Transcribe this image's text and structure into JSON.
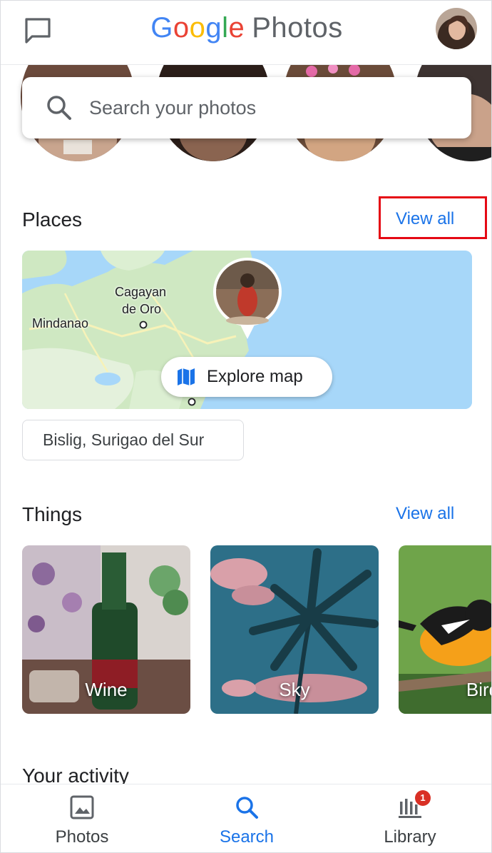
{
  "header": {
    "logo_google": [
      "G",
      "o",
      "o",
      "g",
      "l",
      "e"
    ],
    "logo_photos": "Photos"
  },
  "search": {
    "placeholder": "Search your photos"
  },
  "places": {
    "title": "Places",
    "view_all": "View all",
    "map_labels": {
      "cagayan": "Cagayan",
      "de_oro": "de Oro",
      "mindanao": "Mindanao"
    },
    "explore_map": "Explore map",
    "chip": "Bislig, Surigao del Sur"
  },
  "things": {
    "title": "Things",
    "view_all": "View all",
    "items": [
      {
        "label": "Wine"
      },
      {
        "label": "Sky"
      },
      {
        "label": "Bird"
      }
    ]
  },
  "activity": {
    "title": "Your activity"
  },
  "bottom_nav": {
    "items": [
      {
        "label": "Photos",
        "icon": "image-icon"
      },
      {
        "label": "Search",
        "icon": "search-icon",
        "active": true
      },
      {
        "label": "Library",
        "icon": "library-icon",
        "badge": "1"
      }
    ]
  },
  "colors": {
    "accent": "#1a73e8",
    "highlight": "#e50914",
    "badge": "#d93025",
    "map_water": "#a7d7f9"
  }
}
